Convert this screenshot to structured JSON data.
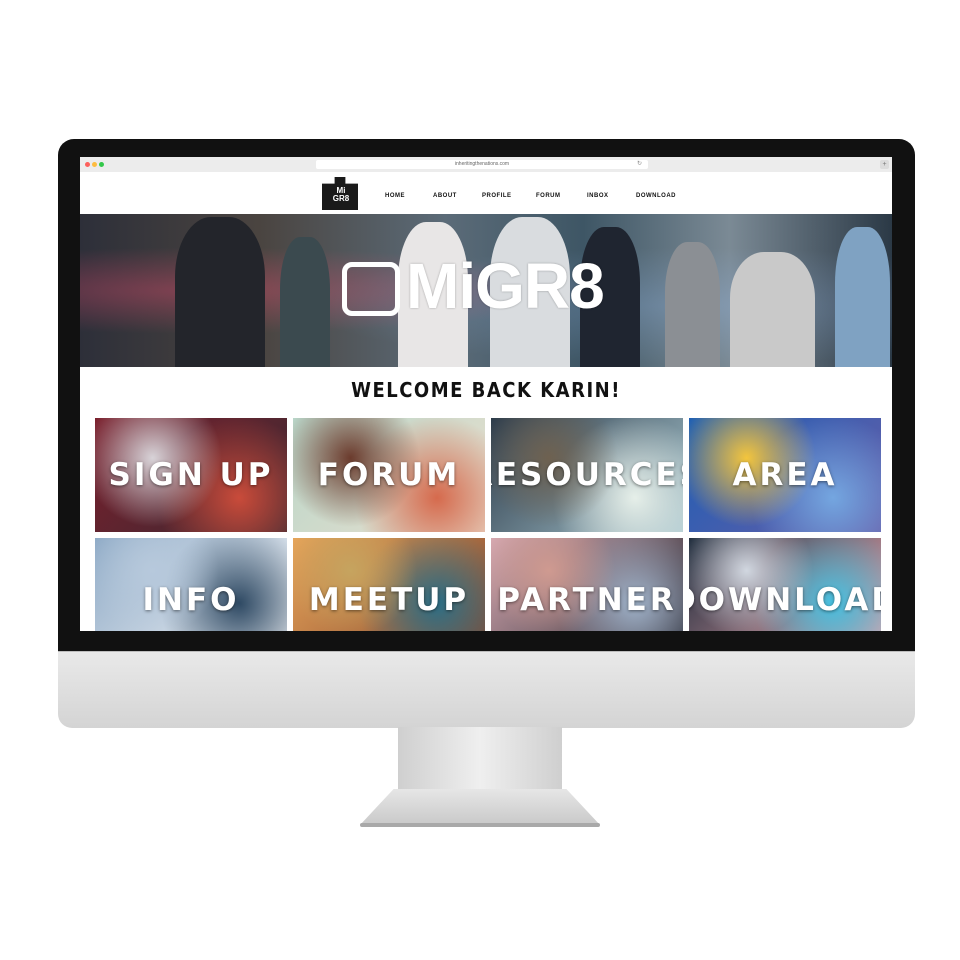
{
  "browser": {
    "url": "inheritingthenations.com"
  },
  "brand": {
    "logo_text": "Mi GR8",
    "hero_title": "MiGR8"
  },
  "nav": {
    "items": [
      "HOME",
      "ABOUT",
      "PROFILE",
      "FORUM",
      "INBOX",
      "DOWNLOAD"
    ]
  },
  "welcome": "WELCOME BACK KARIN!",
  "tiles": [
    {
      "label": "SIGN UP",
      "colors": [
        "#7a1f2c",
        "#c94b3a",
        "#d8d3d8",
        "#3a2a33"
      ]
    },
    {
      "label": "FORUM",
      "colors": [
        "#b9d6c9",
        "#d66a4d",
        "#6b3b2d",
        "#eadfce"
      ]
    },
    {
      "label": "RESOURCES",
      "colors": [
        "#2c3b4a",
        "#e6efe9",
        "#6e6150",
        "#a8c6cf"
      ]
    },
    {
      "label": "AREA",
      "colors": [
        "#1d5fb4",
        "#74a6e0",
        "#f3c53d",
        "#6a5da8"
      ]
    },
    {
      "label": "INFO",
      "colors": [
        "#8eaac6",
        "#2e4963",
        "#b7c9dc",
        "#f0f2f5"
      ]
    },
    {
      "label": "MEETUP",
      "colors": [
        "#e7a55a",
        "#2b6e86",
        "#c6a45f",
        "#8a4a2f"
      ]
    },
    {
      "label": "PARTNER",
      "colors": [
        "#d7a9b1",
        "#9fb2c9",
        "#cf9a90",
        "#2d2d37"
      ]
    },
    {
      "label": "DOWNLOAD",
      "colors": [
        "#1c2a3a",
        "#46c0e0",
        "#d1d7e0",
        "#e2a0a8"
      ]
    }
  ]
}
